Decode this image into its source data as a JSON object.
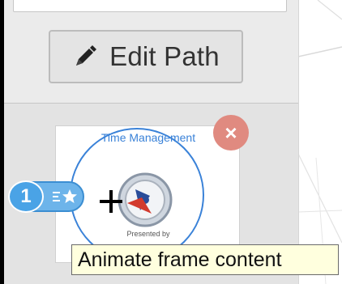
{
  "toolbar": {
    "edit_path_label": "Edit Path"
  },
  "icons": {
    "edit": "pencil-icon",
    "delete": "close-icon",
    "animate": "star-animation-icon",
    "cursor": "move-cursor-icon"
  },
  "frame": {
    "order_number": "1",
    "content_title": "Time Management",
    "content_subtitle": "Presented by"
  },
  "tooltip": {
    "text": "Animate frame content"
  },
  "colors": {
    "accent_blue": "#4aa3e6",
    "delete_red": "#e08a80",
    "tooltip_bg": "#ffffde"
  }
}
